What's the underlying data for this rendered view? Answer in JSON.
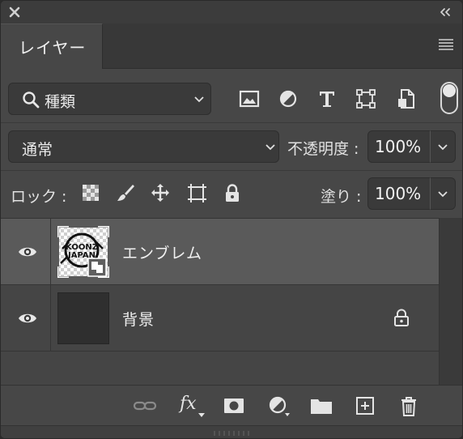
{
  "panel": {
    "title_tab": "レイヤー",
    "icons": {
      "close": "close-icon",
      "collapse": "double-chevron-left-icon",
      "menu": "panel-menu-icon"
    }
  },
  "filter": {
    "kind_label": "種類",
    "icons": [
      "image-filter-icon",
      "adjustment-filter-icon",
      "text-filter-icon",
      "shape-filter-icon",
      "smart-object-filter-icon"
    ],
    "toggle_on": false
  },
  "blend": {
    "mode": "通常",
    "opacity_label": "不透明度 :",
    "opacity_value": "100%"
  },
  "lock": {
    "label": "ロック :",
    "icons": [
      "lock-transparent-pixels-icon",
      "lock-image-pixels-icon",
      "lock-position-icon",
      "lock-artboard-icon",
      "lock-all-icon"
    ],
    "fill_label": "塗り :",
    "fill_value": "100%"
  },
  "layers": [
    {
      "name": "エンブレム",
      "selected": true,
      "visible": true,
      "locked": false,
      "thumb_text": [
        "KOONZ",
        "JAPAN"
      ]
    },
    {
      "name": "背景",
      "selected": false,
      "visible": true,
      "locked": true
    }
  ],
  "toolbar": {
    "icons": [
      "link-layers-icon",
      "fx-icon",
      "layer-mask-icon",
      "adjustment-layer-icon",
      "group-folder-icon",
      "new-layer-icon",
      "trash-icon"
    ],
    "fx_label": "fx"
  },
  "colors": {
    "panel_bg": "#474747",
    "selected_row": "#5a5a5a",
    "field_bg": "#3a3a3a"
  }
}
